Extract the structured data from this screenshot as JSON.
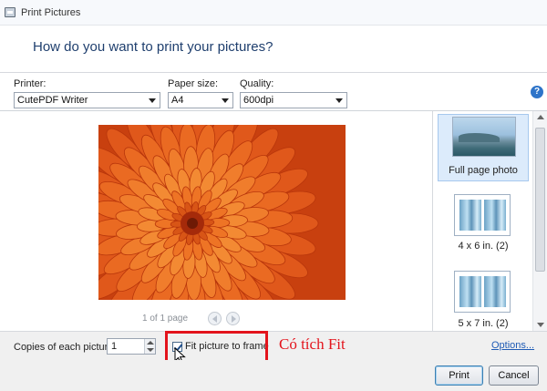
{
  "window": {
    "title": "Print Pictures"
  },
  "header": {
    "question": "How do you want to print your pictures?"
  },
  "settings": {
    "printer_label": "Printer:",
    "printer_value": "CutePDF Writer",
    "paper_label": "Paper size:",
    "paper_value": "A4",
    "quality_label": "Quality:",
    "quality_value": "600dpi",
    "help_glyph": "?"
  },
  "preview": {
    "page_indicator": "1 of 1 page"
  },
  "layouts": [
    {
      "caption": "Full page photo",
      "selected": true
    },
    {
      "caption": "4 x 6 in. (2)",
      "selected": false
    },
    {
      "caption": "5 x 7 in. (2)",
      "selected": false
    }
  ],
  "options": {
    "copies_label": "Copies of each picture:",
    "copies_value": "1",
    "fit_label": "Fit picture to frame",
    "fit_checked": true,
    "options_link": "Options..."
  },
  "annotation": {
    "text": "Có tích Fit",
    "color": "#e3141c"
  },
  "buttons": {
    "print": "Print",
    "cancel": "Cancel"
  },
  "colors": {
    "accent": "#2e74c9",
    "heading": "#1f3f6e",
    "highlight": "#e3141c"
  }
}
